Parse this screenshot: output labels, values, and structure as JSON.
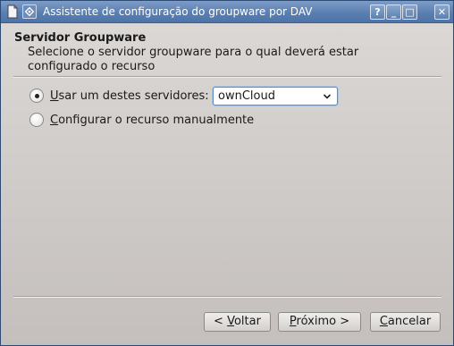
{
  "window": {
    "title": "Assistente de configuração do groupware por DAV",
    "buttons": {
      "help": "?",
      "minimize": "_",
      "maximize": "□",
      "close": "✕"
    }
  },
  "header": {
    "title": "Servidor Groupware",
    "description": "Selecione o servidor groupware para o qual deverá estar configurado o recurso"
  },
  "options": {
    "use_server": {
      "mnemonic": "U",
      "rest": "sar um destes servidores:",
      "selected": true
    },
    "manual": {
      "mnemonic": "C",
      "rest": "onfigurar o recurso manualmente",
      "selected": false
    }
  },
  "server_select": {
    "value": "ownCloud"
  },
  "footer": {
    "back": {
      "prefix": "< ",
      "mnemonic": "V",
      "rest": "oltar"
    },
    "next": {
      "prefix": "",
      "mnemonic": "P",
      "rest": "róximo >"
    },
    "cancel": {
      "prefix": "",
      "mnemonic": "C",
      "rest": "ancelar"
    }
  },
  "colors": {
    "titlebar": "#5a7fb2",
    "focus": "#5b8cc8",
    "background": "#d6d2d0"
  }
}
